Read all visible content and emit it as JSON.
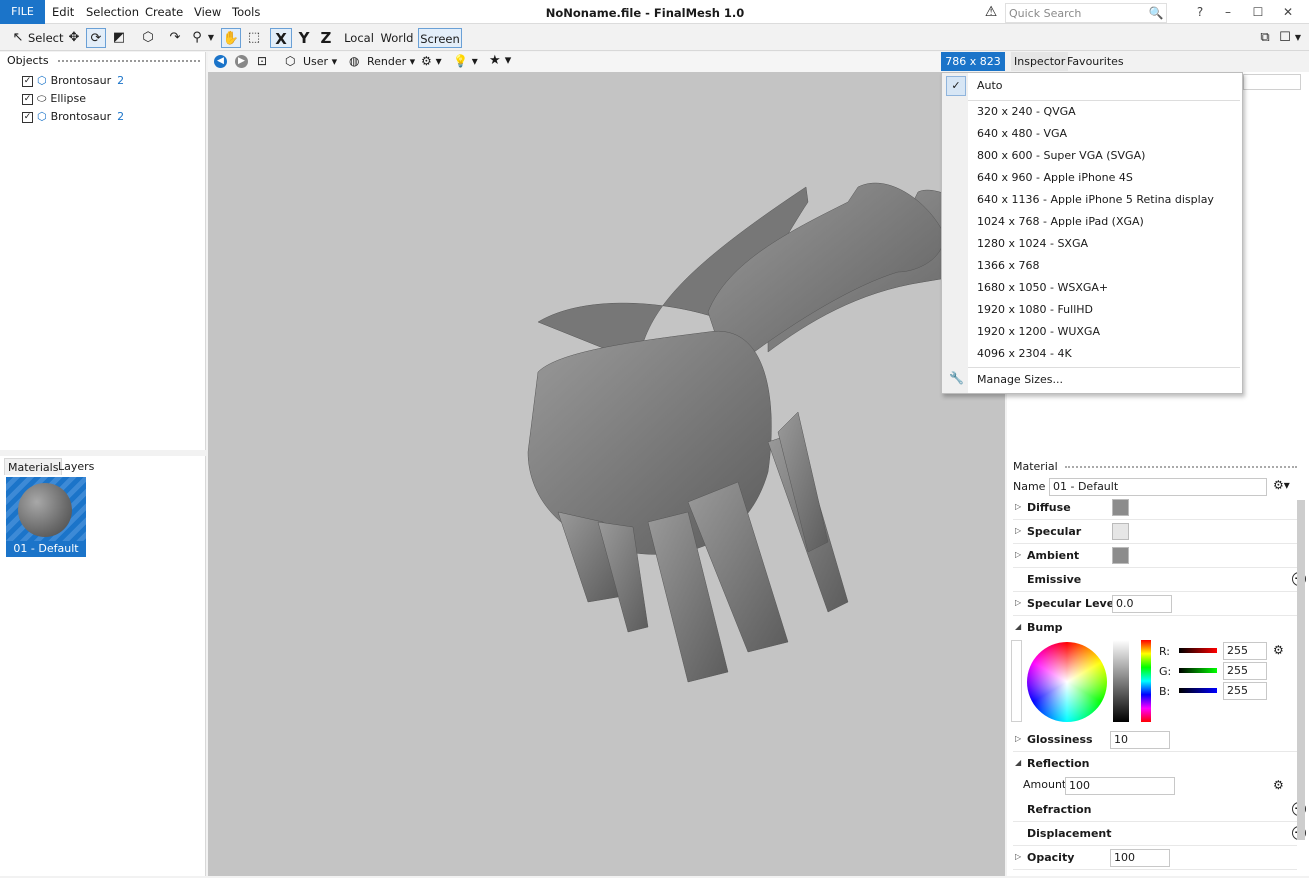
{
  "app": {
    "title": "NoNoname.file - FinalMesh 1.0",
    "file_label": "FILE"
  },
  "menu": [
    "Edit",
    "Selection",
    "Create",
    "View",
    "Tools"
  ],
  "search": {
    "placeholder": "Quick Search"
  },
  "toolbar": {
    "select_label": "Select",
    "x": "X",
    "y": "Y",
    "z": "Z",
    "local": "Local",
    "world": "World",
    "screen": "Screen"
  },
  "objects": {
    "title": "Objects",
    "items": [
      {
        "label": "Brontosaur",
        "count": "2",
        "checked": true,
        "icon": "mesh-icon"
      },
      {
        "label": "Ellipse",
        "count": "",
        "checked": true,
        "icon": "ellipse-icon"
      },
      {
        "label": "Brontosaur",
        "count": "2",
        "checked": true,
        "icon": "mesh-icon"
      }
    ]
  },
  "materials": {
    "tabs": [
      "Materials",
      "Layers"
    ],
    "items": [
      {
        "label": "01 - Default"
      }
    ]
  },
  "viewbar": {
    "camera": "User",
    "render": "Render",
    "size": "786 x 823"
  },
  "right_tabs": [
    "Inspector",
    "Favourites"
  ],
  "size_menu": {
    "auto": "Auto",
    "items": [
      "320 x 240 - QVGA",
      "640 x 480 - VGA",
      "800 x 600 - Super VGA (SVGA)",
      "640 x 960 - Apple iPhone 4S",
      "640 x 1136 - Apple iPhone 5 Retina display",
      "1024 x 768 - Apple iPad (XGA)",
      "1280 x 1024 - SXGA",
      "1366 x 768",
      "1680 x 1050 - WSXGA+",
      "1920 x 1080 - FullHD",
      "1920 x 1200 - WUXGA",
      "4096 x 2304 - 4K"
    ],
    "manage": "Manage Sizes..."
  },
  "material": {
    "section": "Material",
    "name_label": "Name",
    "name_value": "01 - Default",
    "diffuse": "Diffuse",
    "specular": "Specular",
    "ambient": "Ambient",
    "emissive": "Emissive",
    "specular_level": "Specular Level",
    "specular_level_value": "0.0",
    "bump": "Bump",
    "r_label": "R:",
    "g_label": "G:",
    "b_label": "B:",
    "r": "255",
    "g": "255",
    "b": "255",
    "glossiness": "Glossiness",
    "glossiness_value": "10",
    "reflection": "Reflection",
    "amount_label": "Amount",
    "amount_value": "100",
    "refraction": "Refraction",
    "displacement": "Displacement",
    "opacity": "Opacity",
    "opacity_value": "100"
  },
  "colors": {
    "accent": "#1b74c9",
    "viewport": "#c4c4c4",
    "diffuse": "#8c8c8c",
    "specular": "#e6e6e6",
    "ambient": "#8c8c8c"
  }
}
